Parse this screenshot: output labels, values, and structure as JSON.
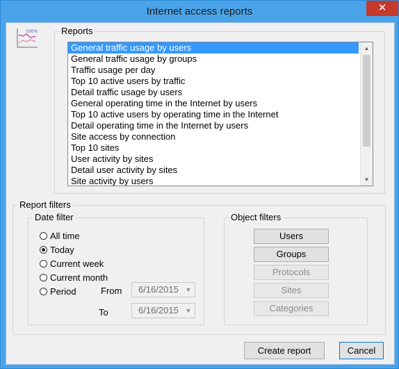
{
  "window": {
    "title": "Internet access reports",
    "close_glyph": "✕"
  },
  "reports": {
    "legend": "Reports",
    "items": [
      "General traffic usage by users",
      "General traffic usage by groups",
      "Traffic usage per day",
      "Top 10 active users by traffic",
      "Detail traffic usage by users",
      "General operating time in the Internet by users",
      "Top 10 active users by  operating time in the Internet",
      "Detail operating time in the Internet by users",
      "Site access by connection",
      "Top 10 sites",
      "User activity by sites",
      "Detail user activity by sites",
      "Site activity by users"
    ],
    "selected_index": 0,
    "icon_label": "100%"
  },
  "filters": {
    "legend": "Report filters",
    "date": {
      "legend": "Date filter",
      "options": [
        "All time",
        "Today",
        "Current week",
        "Current month",
        "Period"
      ],
      "selected": "Today",
      "from_label": "From",
      "to_label": "To",
      "from_value": "6/16/2015",
      "to_value": "6/16/2015"
    },
    "object": {
      "legend": "Object filters",
      "buttons": [
        "Users",
        "Groups",
        "Protocols",
        "Sites",
        "Categories"
      ],
      "enabled": [
        true,
        true,
        false,
        false,
        false
      ]
    }
  },
  "footer": {
    "create_label": "Create report",
    "cancel_label": "Cancel"
  },
  "colors": {
    "title_bar": "#4aa3e8",
    "selection": "#3399ff",
    "close_button": "#c7392b"
  }
}
